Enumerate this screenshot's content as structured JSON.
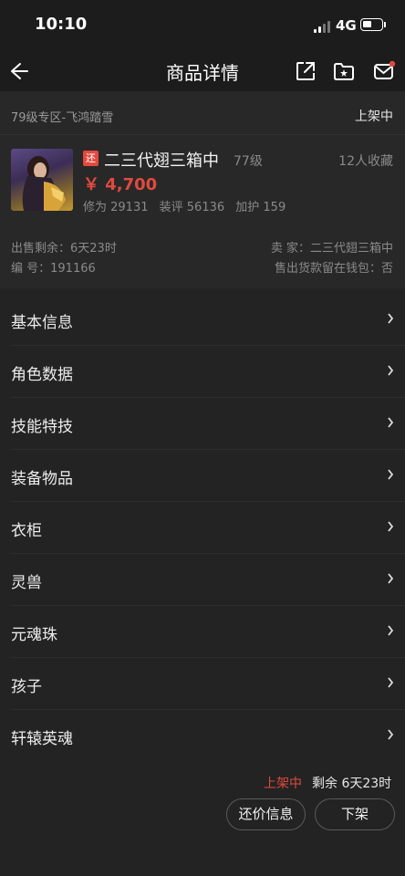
{
  "status_bar": {
    "time": "10:10",
    "network": "4G"
  },
  "nav": {
    "title": "商品详情",
    "icons": [
      "back-arrow-icon",
      "share-icon",
      "folder-icon",
      "message-icon"
    ],
    "notification_dot_color": "#e24a3e"
  },
  "zone": {
    "name": "79级专区-飞鸿踏雪",
    "status": "上架中"
  },
  "item": {
    "badge": "还",
    "name": "二三代翅三箱中",
    "level": "77级",
    "favorites": "12人收藏",
    "price": "￥ 4,700",
    "stats": [
      "修为 29131",
      "装评 56136",
      "加护 159"
    ],
    "time_left": "出售剩余：6天23时",
    "seller": "卖 家：二三代翅三箱中",
    "number": "编 号：191166",
    "wallet": "售出货款留在钱包：否"
  },
  "menu": [
    {
      "label": "基本信息"
    },
    {
      "label": "角色数据"
    },
    {
      "label": "技能特技"
    },
    {
      "label": "装备物品"
    },
    {
      "label": "衣柜"
    },
    {
      "label": "灵兽"
    },
    {
      "label": "元魂珠"
    },
    {
      "label": "孩子"
    },
    {
      "label": "轩辕英魂"
    }
  ],
  "footer": {
    "status": "上架中",
    "remaining": "剩余 6天23时",
    "counter_offer_button": "还价信息",
    "delist_button": "下架"
  },
  "colors": {
    "accent_red": "#e04a3e",
    "background": "#232323"
  }
}
